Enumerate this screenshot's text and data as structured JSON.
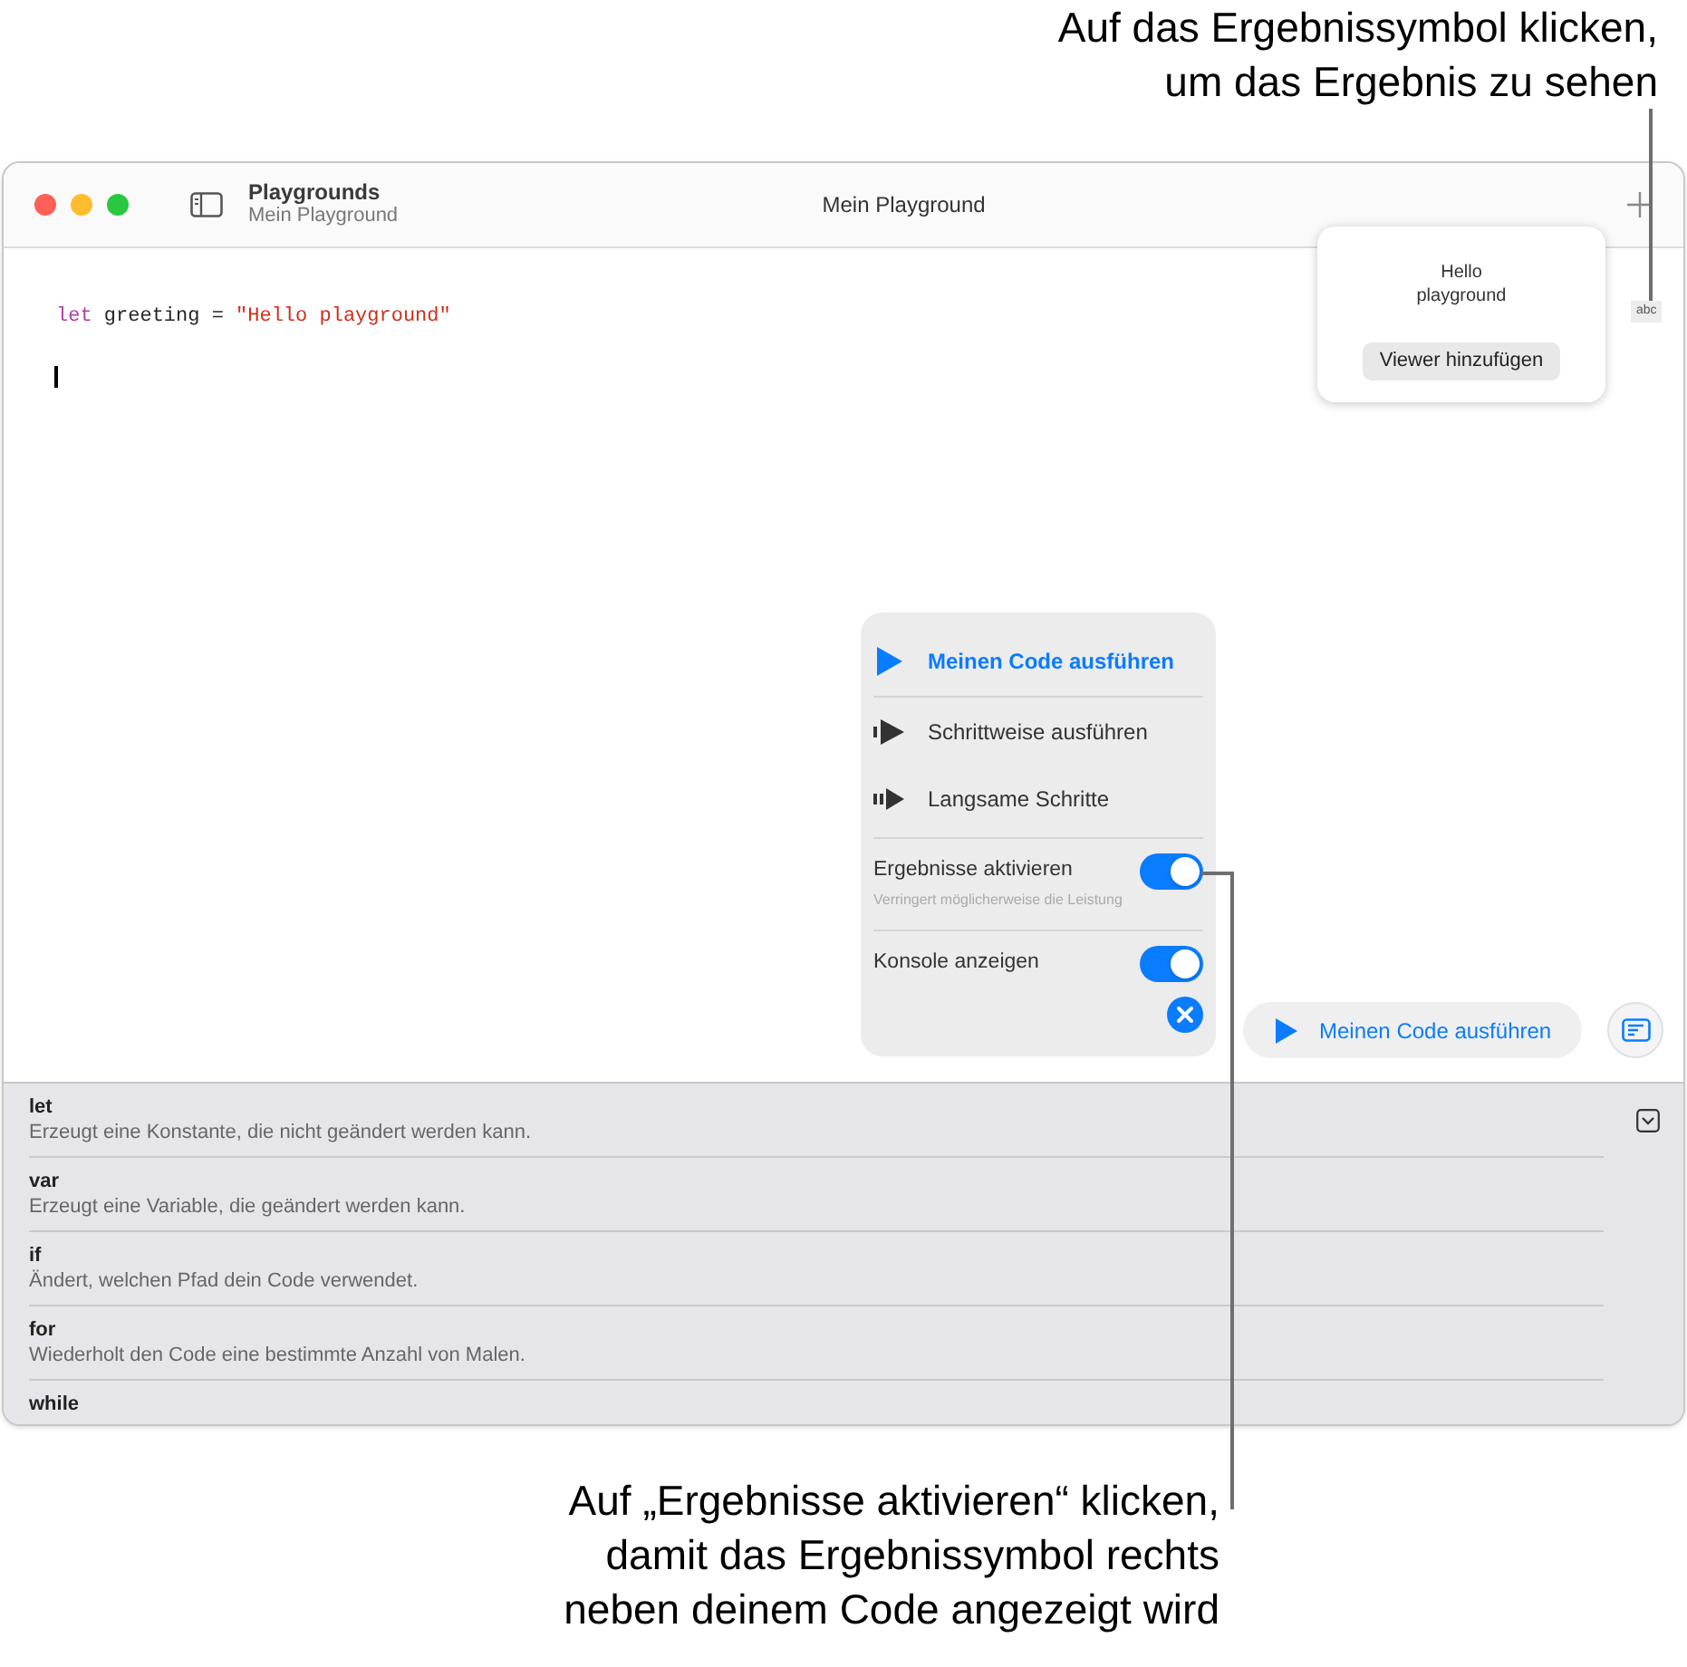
{
  "top_callout": {
    "lines": [
      "Auf das Ergebnissymbol klicken,",
      "um das Ergebnis zu sehen"
    ]
  },
  "bottom_callout": {
    "lines": [
      "Auf „Ergebnisse aktivieren“ klicken,",
      "damit das Ergebnissymbol rechts",
      "neben deinem Code angezeigt wird"
    ]
  },
  "window": {
    "title": "Mein Playground",
    "app": "Playgrounds",
    "subtitle": "Mein Playground"
  },
  "code": [
    {
      "kind": "keyword",
      "text": "let"
    },
    {
      "kind": "plain",
      "text": " greeting = "
    },
    {
      "kind": "string",
      "text": "\"Hello playground\""
    }
  ],
  "result": {
    "value": "Hello playground",
    "button": "Viewer hinzufügen",
    "badge": "abc"
  },
  "run_menu": {
    "items": [
      {
        "kind": "run",
        "label": "Meinen Code ausführen"
      },
      {
        "kind": "step",
        "label": "Schrittweise ausführen"
      },
      {
        "kind": "slow",
        "label": "Langsame Schritte"
      }
    ],
    "toggles": [
      {
        "label": "Ergebnisse aktivieren",
        "hint": "Verringert möglicherweise die Leistung",
        "on": true
      },
      {
        "label": "Konsole anzeigen",
        "on": true
      }
    ]
  },
  "run_button": {
    "label": "Meinen Code ausführen"
  },
  "docs": [
    {
      "keyword": "let",
      "description": "Erzeugt eine Konstante, die nicht geändert werden kann."
    },
    {
      "keyword": "var",
      "description": "Erzeugt eine Variable, die geändert werden kann."
    },
    {
      "keyword": "if",
      "description": "Ändert, welchen Pfad dein Code verwendet."
    },
    {
      "keyword": "for",
      "description": "Wiederholt den Code eine bestimmte Anzahl von Malen."
    },
    {
      "keyword": "while"
    }
  ]
}
